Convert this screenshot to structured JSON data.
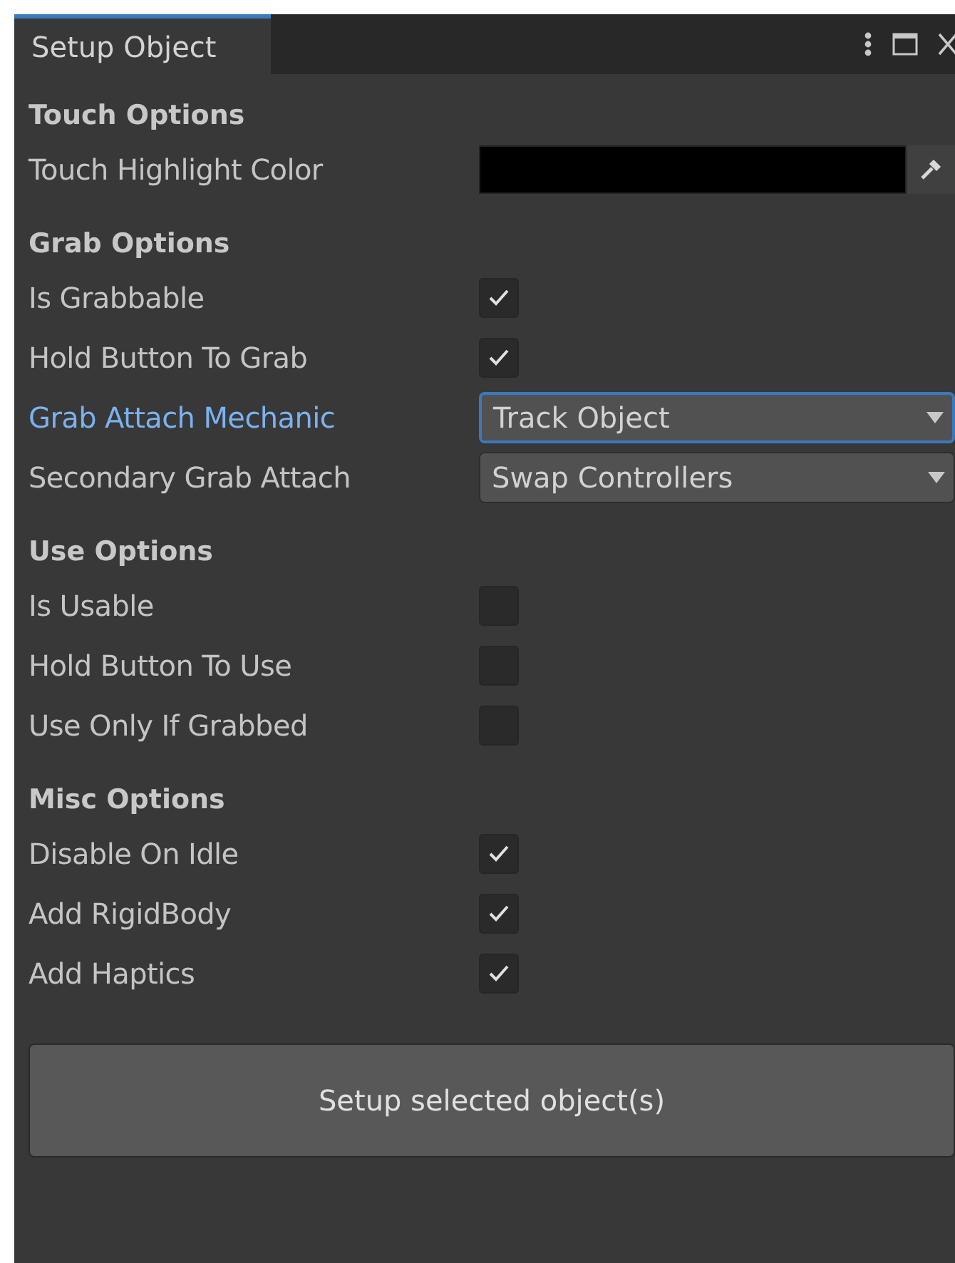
{
  "window": {
    "tab": {
      "title": "Setup Object",
      "selected": true
    }
  },
  "sections": [
    {
      "heading": "Touch Options",
      "rows": [
        {
          "kind": "color",
          "label": "Touch Highlight Color",
          "color": "#000000"
        }
      ]
    },
    {
      "heading": "Grab Options",
      "rows": [
        {
          "kind": "toggle",
          "label": "Is Grabbable",
          "checked": true
        },
        {
          "kind": "toggle",
          "label": "Hold Button To Grab",
          "checked": true
        },
        {
          "kind": "dropdown",
          "label": "Grab Attach Mechanic",
          "value": "Track Object",
          "focused": true
        },
        {
          "kind": "dropdown",
          "label": "Secondary Grab Attach",
          "value": "Swap Controllers",
          "focused": false
        }
      ]
    },
    {
      "heading": "Use Options",
      "rows": [
        {
          "kind": "toggle",
          "label": "Is Usable",
          "checked": false
        },
        {
          "kind": "toggle",
          "label": "Hold Button To Use",
          "checked": false
        },
        {
          "kind": "toggle",
          "label": "Use Only If Grabbed",
          "checked": false
        }
      ]
    },
    {
      "heading": "Misc Options",
      "rows": [
        {
          "kind": "toggle",
          "label": "Disable On Idle",
          "checked": true
        },
        {
          "kind": "toggle",
          "label": "Add RigidBody",
          "checked": true
        },
        {
          "kind": "toggle",
          "label": "Add Haptics",
          "checked": true
        }
      ]
    }
  ],
  "button": "Setup selected object(s)"
}
